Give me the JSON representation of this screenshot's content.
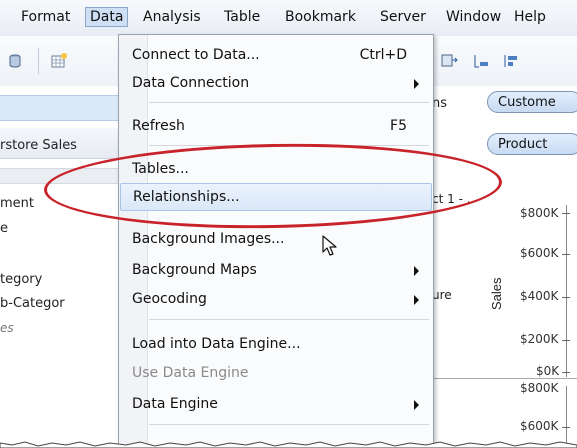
{
  "menubar": {
    "items": [
      "Format",
      "Data",
      "Analysis",
      "Table",
      "Bookmark",
      "Server",
      "Window",
      "Help"
    ],
    "active": "Data"
  },
  "data_menu": {
    "items": [
      {
        "label": "Connect to Data...",
        "shortcut": "Ctrl+D",
        "submenu": false
      },
      {
        "label": "Data Connection",
        "shortcut": "",
        "submenu": true
      },
      {
        "label": "Refresh",
        "shortcut": "F5",
        "submenu": false
      },
      {
        "label": "Tables...",
        "shortcut": "",
        "submenu": false
      },
      {
        "label": "Relationships...",
        "shortcut": "",
        "submenu": false,
        "highlighted": true
      },
      {
        "label": "Background Images...",
        "shortcut": "",
        "submenu": false
      },
      {
        "label": "Background Maps",
        "shortcut": "",
        "submenu": true
      },
      {
        "label": "Geocoding",
        "shortcut": "",
        "submenu": true
      },
      {
        "label": "Load into Data Engine...",
        "shortcut": "",
        "submenu": false
      },
      {
        "label": "Use Data Engine",
        "shortcut": "",
        "submenu": false,
        "disabled": true
      },
      {
        "label": "Data Engine",
        "shortcut": "",
        "submenu": true
      }
    ]
  },
  "left_panel": {
    "tab_label": "rstore Sales",
    "lines": [
      "ment",
      "e",
      "tegory",
      "b-Categor",
      "es"
    ]
  },
  "right_panel": {
    "pill_top": "Custome",
    "pill_bottom": "Product",
    "label_ns": "ns",
    "label_ct": "ct 1 - .",
    "label_ure": "ure",
    "axis_title": "Sales",
    "ticks": [
      "$800K",
      "$600K",
      "$400K",
      "$200K",
      "$0K",
      "$800K",
      "$600K"
    ]
  },
  "colors": {
    "annotation": "#c8232a",
    "highlight": "#dbe8f8"
  }
}
